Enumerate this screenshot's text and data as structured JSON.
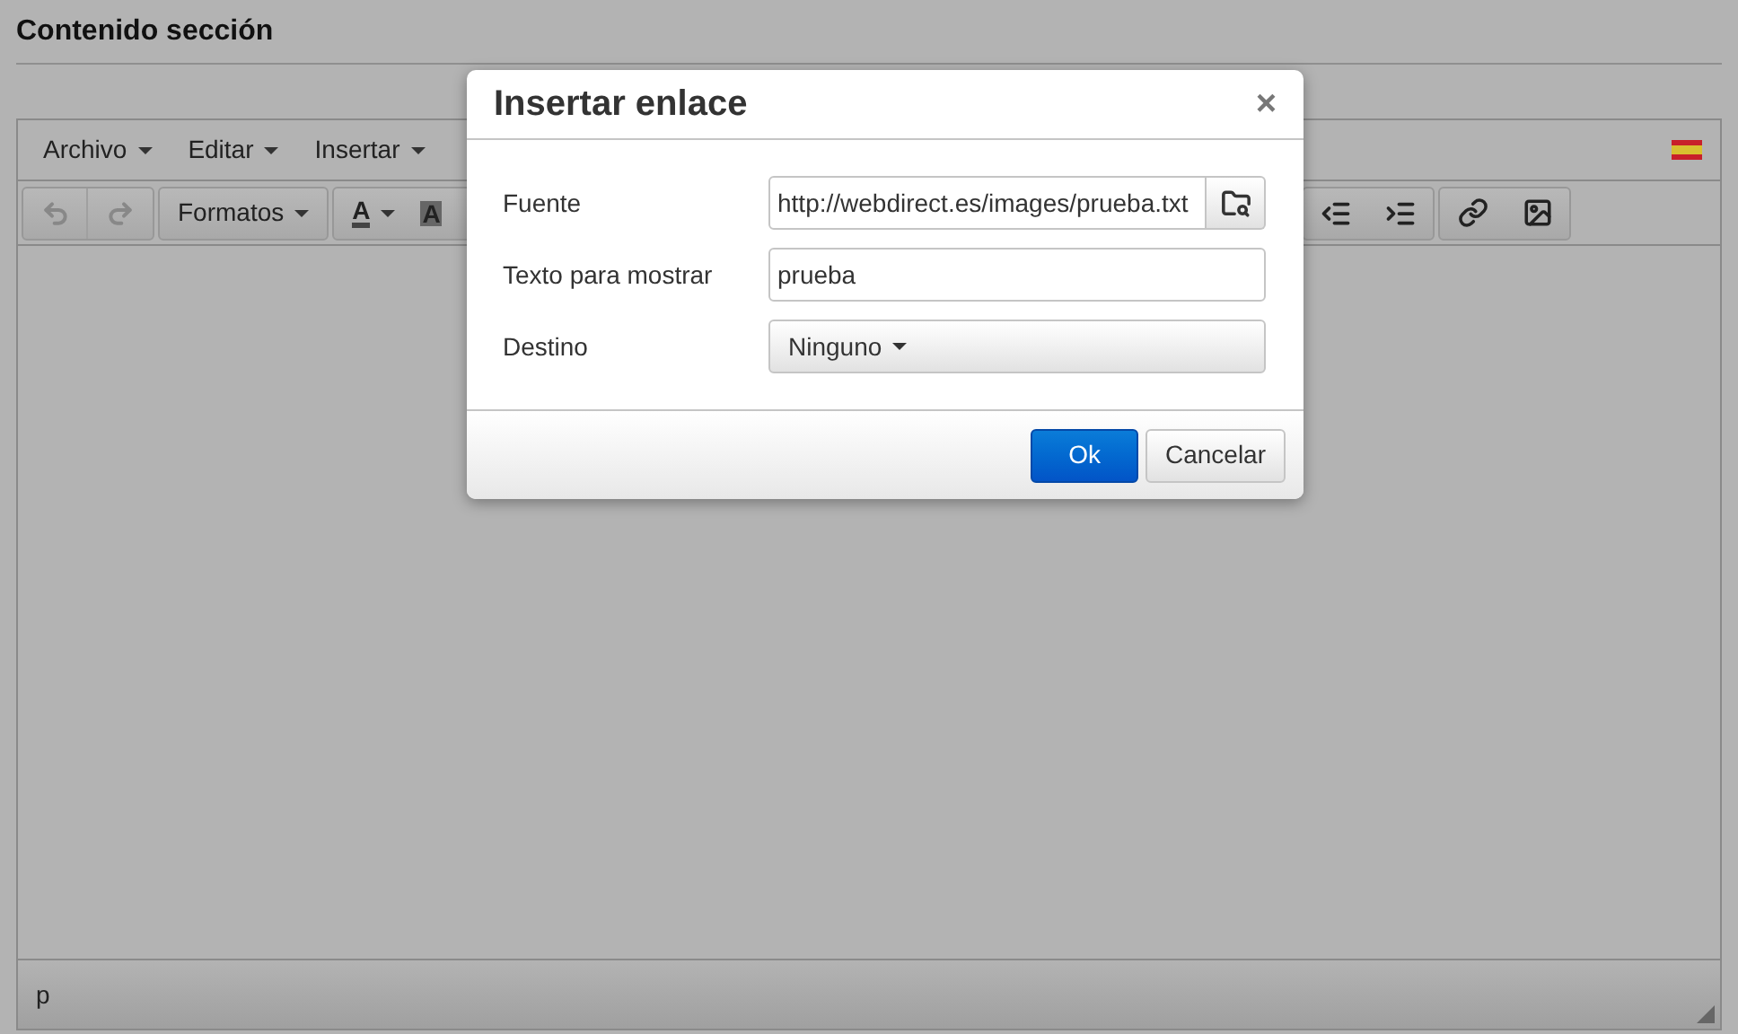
{
  "heading": "Contenido sección",
  "menu": [
    {
      "label": "Archivo"
    },
    {
      "label": "Editar"
    },
    {
      "label": "Insertar"
    }
  ],
  "toolbar": {
    "undo": {
      "disabled": true
    },
    "redo": {
      "disabled": true
    },
    "formats": "Formatos",
    "text_color": "A",
    "background_color": "A"
  },
  "status_bar": {
    "path": "p"
  },
  "dialog": {
    "title": "Insertar enlace",
    "close": "×",
    "fields": [
      {
        "kind": "url",
        "label": "Fuente",
        "value": "http://webdirect.es/images/prueba.txt"
      },
      {
        "kind": "text",
        "label": "Texto para mostrar",
        "value": "prueba"
      },
      {
        "kind": "select",
        "label": "Destino",
        "value": "Ninguno"
      }
    ],
    "buttons": [
      {
        "label": "Ok",
        "primary": true
      },
      {
        "label": "Cancelar",
        "primary": false
      }
    ]
  }
}
